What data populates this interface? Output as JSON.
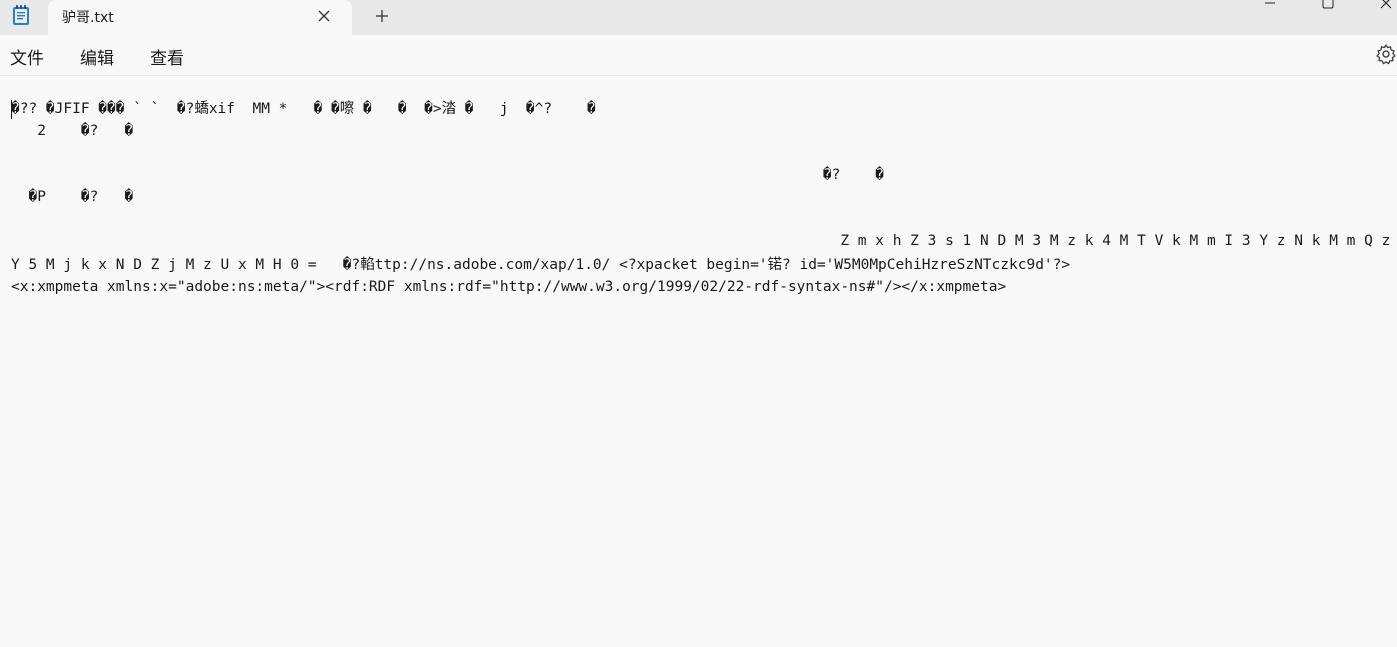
{
  "app": {
    "icon": "notepad-icon",
    "tab_title": "驴哥.txt",
    "close_tab_icon": "close-icon",
    "new_tab_icon": "plus-icon",
    "window_controls": [
      "minimize-icon",
      "maximize-icon",
      "close-icon"
    ]
  },
  "menu": {
    "file": "文件",
    "edit": "编辑",
    "view": "查看",
    "settings_icon": "gear-icon"
  },
  "editor": {
    "lines": [
      "�?? �JFIF ��� ` `  �?蟜xif  MM *   � �嚓 �   �  �>涾 �   j  �^?    �",
      "   2    �?   �",
      "",
      "                                                                                             �?    �",
      "  �P    �?   �",
      "",
      "                                                                                               Z m x h Z 3 s 1 N D M 3 M z k 4 M T V k M m I 3 Y z N k M m Q z Z j",
      "Y 5 M j k x N D Z j M z U x M H 0 =   �?輡ttp://ns.adobe.com/xap/1.0/ <?xpacket begin='锘? id='W5M0MpCehiHzreSzNTczkc9d'?>",
      "<x:xmpmeta xmlns:x=\"adobe:ns:meta/\"><rdf:RDF xmlns:rdf=\"http://www.w3.org/1999/02/22-rdf-syntax-ns#\"/></x:xmpmeta>"
    ]
  }
}
